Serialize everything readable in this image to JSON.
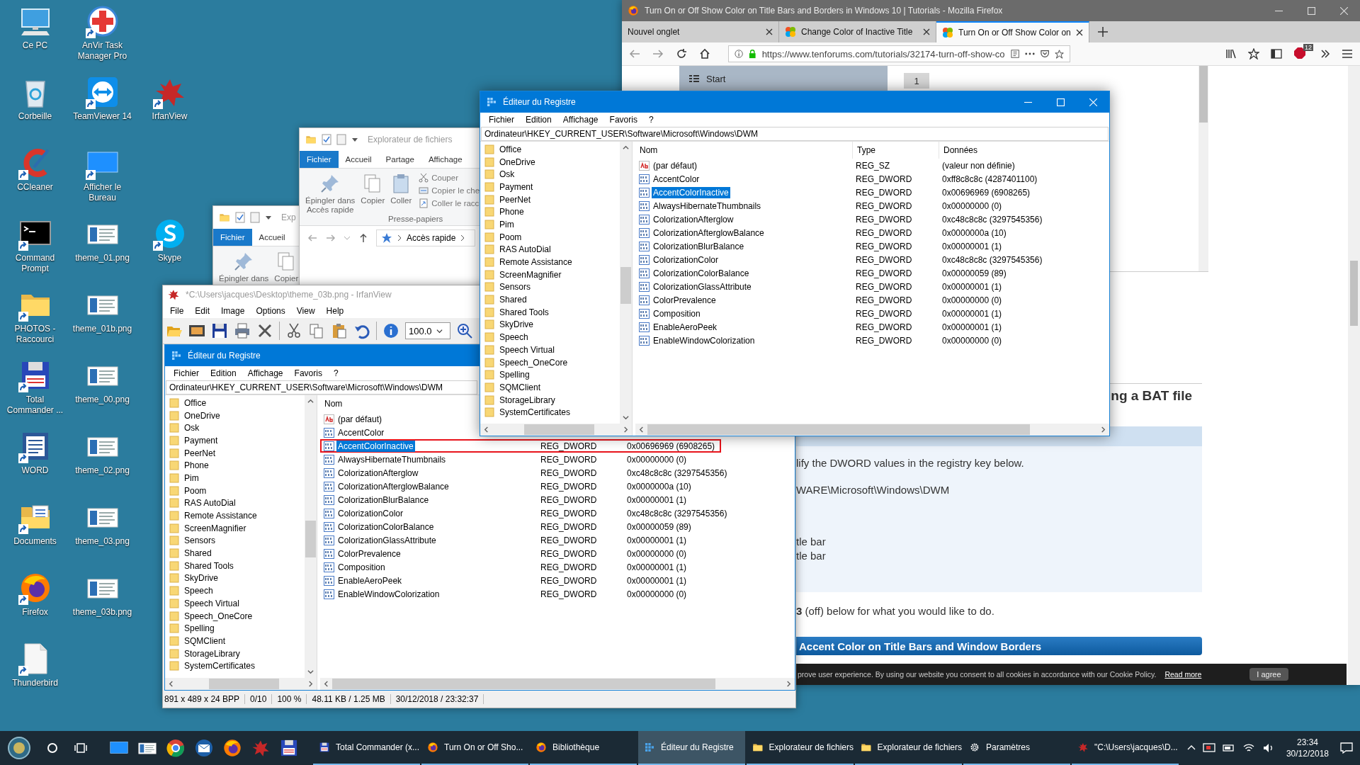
{
  "desktop_icons": [
    {
      "label": "Ce PC",
      "kind": "pc",
      "shortcut": false
    },
    {
      "label": "AnVir Task Manager Pro",
      "kind": "anvir",
      "shortcut": true
    },
    {
      "label": "Corbeille",
      "kind": "recycle",
      "shortcut": false
    },
    {
      "label": "TeamViewer 14",
      "kind": "teamviewer",
      "shortcut": true
    },
    {
      "label": "IrfanView",
      "kind": "irfanview",
      "shortcut": true
    },
    {
      "label": "CCleaner",
      "kind": "ccleaner",
      "shortcut": true
    },
    {
      "label": "Afficher le Bureau",
      "kind": "desktop",
      "shortcut": true
    },
    {
      "label": "Command Prompt",
      "kind": "cmd",
      "shortcut": true
    },
    {
      "label": "theme_01.png",
      "kind": "image",
      "shortcut": false
    },
    {
      "label": "Skype",
      "kind": "skype",
      "shortcut": true
    },
    {
      "label": "PHOTOS - Raccourci",
      "kind": "folder",
      "shortcut": true
    },
    {
      "label": "theme_01b.png",
      "kind": "image",
      "shortcut": false
    },
    {
      "label": "Total Commander ...",
      "kind": "totalcmd",
      "shortcut": true
    },
    {
      "label": "theme_00.png",
      "kind": "image",
      "shortcut": false
    },
    {
      "label": "WORD",
      "kind": "word",
      "shortcut": true
    },
    {
      "label": "theme_02.png",
      "kind": "image",
      "shortcut": false
    },
    {
      "label": "Documents",
      "kind": "documents",
      "shortcut": true
    },
    {
      "label": "theme_03.png",
      "kind": "image",
      "shortcut": false
    },
    {
      "label": "Firefox",
      "kind": "firefox",
      "shortcut": true
    },
    {
      "label": "theme_03b.png",
      "kind": "image",
      "shortcut": false
    },
    {
      "label": "Thunderbird",
      "kind": "page",
      "shortcut": true
    }
  ],
  "explorer_windows": [
    {
      "title": "Explorateur de fichiers",
      "tabs": [
        {
          "label": "Fichier",
          "selected": true
        },
        {
          "label": "Accueil",
          "selected": false
        },
        {
          "label": "Partage",
          "selected": false
        },
        {
          "label": "Affichage",
          "selected": false
        }
      ],
      "ribbon_large": [
        "Épingler dans\nAccès rapide",
        "Copier",
        "Coller"
      ],
      "ribbon_small": [
        "Couper",
        "Copier le che",
        "Coller le racc"
      ],
      "group_label": "Presse-papiers",
      "address": "Accès rapide"
    },
    {
      "title": "Exp",
      "tabs": [
        {
          "label": "Fichier",
          "selected": true
        },
        {
          "label": "Accueil",
          "selected": false
        }
      ],
      "ribbon_large": [
        "Épingler dans",
        "Copier"
      ]
    }
  ],
  "firefox": {
    "title": "Turn On or Off Show Color on Title Bars and Borders in Windows 10 | Tutorials - Mozilla Firefox",
    "tabs": [
      {
        "label": "Nouvel onglet",
        "selected": false,
        "favicon": false
      },
      {
        "label": "Change Color of Inactive Title",
        "selected": false,
        "favicon": true
      },
      {
        "label": "Turn On or Off Show Color on",
        "selected": true,
        "favicon": true
      }
    ],
    "url": "https://www.tenforums.com/tutorials/32174-turn-off-show-co",
    "badge": "12",
    "page": {
      "sidebar_item": "Start",
      "step_box": "1",
      "heading": "ng a BAT file",
      "panel_lines": [
        "lify the DWORD values in the registry key below.",
        "WARE\\Microsoft\\Windows\\DWM",
        "tle bar",
        "tle bar"
      ],
      "instruction": "**3** (off) below for what you would like to do.",
      "section_title": "Accent Color on Title Bars and Window Borders",
      "cookie": {
        "text": "prove user experience. By using our website you consent to all cookies in accordance with our Cookie Policy.",
        "link": "Read more",
        "button": "I agree"
      }
    }
  },
  "irfanview": {
    "title": "*C:\\Users\\jacques\\Desktop\\theme_03b.png - IrfanView",
    "menu": [
      "File",
      "Edit",
      "Image",
      "Options",
      "View",
      "Help"
    ],
    "zoom": "100.0",
    "image": {
      "title": "Éditeur du Registre",
      "menu": [
        "Fichier",
        "Edition",
        "Affichage",
        "Favoris",
        "?"
      ],
      "address": "Ordinateur\\HKEY_CURRENT_USER\\Software\\Microsoft\\Windows\\DWM",
      "tree": [
        "Office",
        "OneDrive",
        "Osk",
        "Payment",
        "PeerNet",
        "Phone",
        "Pim",
        "Poom",
        "RAS AutoDial",
        "Remote Assistance",
        "ScreenMagnifier",
        "Sensors",
        "Shared",
        "Shared Tools",
        "SkyDrive",
        "Speech",
        "Speech Virtual",
        "Speech_OneCore",
        "Spelling",
        "SQMClient",
        "StorageLibrary",
        "SystemCertificates"
      ],
      "columns": [
        "Nom"
      ],
      "values": [
        {
          "name": "(par défaut)",
          "kind": "string",
          "selected": false,
          "outlined": false
        },
        {
          "name": "AccentColor",
          "kind": "dword",
          "selected": false,
          "outlined": false
        },
        {
          "name": "AccentColorInactive",
          "kind": "dword",
          "type": "REG_DWORD",
          "data": "0x00696969 (6908265)",
          "selected": true,
          "outlined": true
        },
        {
          "name": "AlwaysHibernateThumbnails",
          "kind": "dword",
          "type": "REG_DWORD",
          "data": "0x00000000 (0)",
          "selected": false,
          "outlined": false
        },
        {
          "name": "ColorizationAfterglow",
          "kind": "dword",
          "type": "REG_DWORD",
          "data": "0xc48c8c8c (3297545356)",
          "selected": false,
          "outlined": false
        },
        {
          "name": "ColorizationAfterglowBalance",
          "kind": "dword",
          "type": "REG_DWORD",
          "data": "0x0000000a (10)",
          "selected": false,
          "outlined": false
        },
        {
          "name": "ColorizationBlurBalance",
          "kind": "dword",
          "type": "REG_DWORD",
          "data": "0x00000001 (1)",
          "selected": false,
          "outlined": false
        },
        {
          "name": "ColorizationColor",
          "kind": "dword",
          "type": "REG_DWORD",
          "data": "0xc48c8c8c (3297545356)",
          "selected": false,
          "outlined": false
        },
        {
          "name": "ColorizationColorBalance",
          "kind": "dword",
          "type": "REG_DWORD",
          "data": "0x00000059 (89)",
          "selected": false,
          "outlined": false
        },
        {
          "name": "ColorizationGlassAttribute",
          "kind": "dword",
          "type": "REG_DWORD",
          "data": "0x00000001 (1)",
          "selected": false,
          "outlined": false
        },
        {
          "name": "ColorPrevalence",
          "kind": "dword",
          "type": "REG_DWORD",
          "data": "0x00000000 (0)",
          "selected": false,
          "outlined": false
        },
        {
          "name": "Composition",
          "kind": "dword",
          "type": "REG_DWORD",
          "data": "0x00000001 (1)",
          "selected": false,
          "outlined": false
        },
        {
          "name": "EnableAeroPeek",
          "kind": "dword",
          "type": "REG_DWORD",
          "data": "0x00000001 (1)",
          "selected": false,
          "outlined": false
        },
        {
          "name": "EnableWindowColorization",
          "kind": "dword",
          "type": "REG_DWORD",
          "data": "0x00000000 (0)",
          "selected": false,
          "outlined": false
        }
      ]
    },
    "status": [
      "891 x 489 x 24 BPP",
      "0/10",
      "100 %",
      "48.11 KB / 1.25 MB",
      "30/12/2018 / 23:32:37"
    ]
  },
  "registry": {
    "title": "Éditeur du Registre",
    "menu": [
      "Fichier",
      "Edition",
      "Affichage",
      "Favoris",
      "?"
    ],
    "address": "Ordinateur\\HKEY_CURRENT_USER\\Software\\Microsoft\\Windows\\DWM",
    "tree": [
      "Office",
      "OneDrive",
      "Osk",
      "Payment",
      "PeerNet",
      "Phone",
      "Pim",
      "Poom",
      "RAS AutoDial",
      "Remote Assistance",
      "ScreenMagnifier",
      "Sensors",
      "Shared",
      "Shared Tools",
      "SkyDrive",
      "Speech",
      "Speech Virtual",
      "Speech_OneCore",
      "Spelling",
      "SQMClient",
      "StorageLibrary",
      "SystemCertificates"
    ],
    "columns": [
      "Nom",
      "Type",
      "Données"
    ],
    "values": [
      {
        "name": "(par défaut)",
        "kind": "string",
        "type": "REG_SZ",
        "data": "(valeur non définie)",
        "selected": false
      },
      {
        "name": "AccentColor",
        "kind": "dword",
        "type": "REG_DWORD",
        "data": "0xff8c8c8c (4287401100)",
        "selected": false
      },
      {
        "name": "AccentColorInactive",
        "kind": "dword",
        "type": "REG_DWORD",
        "data": "0x00696969 (6908265)",
        "selected": true
      },
      {
        "name": "AlwaysHibernateThumbnails",
        "kind": "dword",
        "type": "REG_DWORD",
        "data": "0x00000000 (0)",
        "selected": false
      },
      {
        "name": "ColorizationAfterglow",
        "kind": "dword",
        "type": "REG_DWORD",
        "data": "0xc48c8c8c (3297545356)",
        "selected": false
      },
      {
        "name": "ColorizationAfterglowBalance",
        "kind": "dword",
        "type": "REG_DWORD",
        "data": "0x0000000a (10)",
        "selected": false
      },
      {
        "name": "ColorizationBlurBalance",
        "kind": "dword",
        "type": "REG_DWORD",
        "data": "0x00000001 (1)",
        "selected": false
      },
      {
        "name": "ColorizationColor",
        "kind": "dword",
        "type": "REG_DWORD",
        "data": "0xc48c8c8c (3297545356)",
        "selected": false
      },
      {
        "name": "ColorizationColorBalance",
        "kind": "dword",
        "type": "REG_DWORD",
        "data": "0x00000059 (89)",
        "selected": false
      },
      {
        "name": "ColorizationGlassAttribute",
        "kind": "dword",
        "type": "REG_DWORD",
        "data": "0x00000001 (1)",
        "selected": false
      },
      {
        "name": "ColorPrevalence",
        "kind": "dword",
        "type": "REG_DWORD",
        "data": "0x00000000 (0)",
        "selected": false
      },
      {
        "name": "Composition",
        "kind": "dword",
        "type": "REG_DWORD",
        "data": "0x00000001 (1)",
        "selected": false
      },
      {
        "name": "EnableAeroPeek",
        "kind": "dword",
        "type": "REG_DWORD",
        "data": "0x00000001 (1)",
        "selected": false
      },
      {
        "name": "EnableWindowColorization",
        "kind": "dword",
        "type": "REG_DWORD",
        "data": "0x00000000 (0)",
        "selected": false
      }
    ]
  },
  "taskbar": {
    "buttons": [
      {
        "label": "Total Commander (x...",
        "kind": "totalcmd",
        "selected": false
      },
      {
        "label": "Turn On or Off Sho...",
        "kind": "firefox",
        "selected": false
      },
      {
        "label": "Bibliothèque",
        "kind": "firefox",
        "selected": false
      },
      {
        "label": "Éditeur du Registre",
        "kind": "regedit",
        "selected": true
      },
      {
        "label": "Explorateur de fichiers",
        "kind": "folder",
        "selected": false
      },
      {
        "label": "Explorateur de fichiers",
        "kind": "folder",
        "selected": false
      },
      {
        "label": "Paramètres",
        "kind": "settings",
        "selected": false
      },
      {
        "label": "\"C:\\Users\\jacques\\D...",
        "kind": "irfanview",
        "selected": false
      }
    ],
    "time": "23:34",
    "date": "30/12/2018"
  }
}
